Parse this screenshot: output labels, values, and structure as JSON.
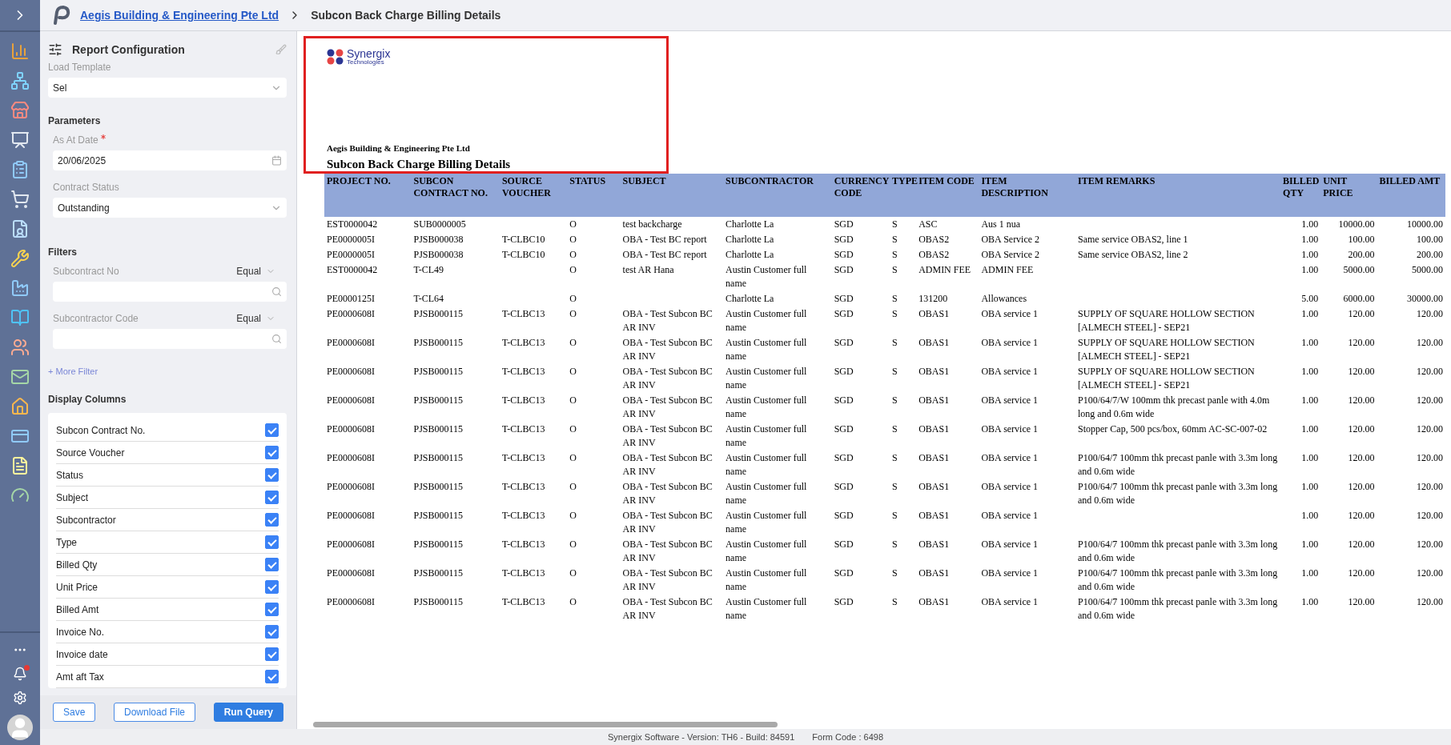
{
  "breadcrumb": [
    {
      "label": "Aegis Building & Engineering Pte Ltd",
      "kind": "link"
    },
    {
      "label": "Subcon Back Charge Billing Details",
      "kind": "current"
    }
  ],
  "config": {
    "title": "Report Configuration",
    "load_template": {
      "label": "Load Template",
      "value": "Sel"
    },
    "parameters_heading": "Parameters",
    "params": [
      {
        "label": "As At Date",
        "required": true,
        "value": "20/06/2025",
        "kind": "date"
      },
      {
        "label": "Contract Status",
        "required": false,
        "value": "Outstanding",
        "kind": "select"
      }
    ],
    "filters_heading": "Filters",
    "filters": [
      {
        "label": "Subcontract No",
        "operator": "Equal"
      },
      {
        "label": "Subcontractor Code",
        "operator": "Equal"
      }
    ],
    "more_filter": "+ More Filter",
    "display_heading": "Display Columns",
    "display_columns": [
      {
        "label": "Subcon Contract No.",
        "checked": true
      },
      {
        "label": "Source Voucher",
        "checked": true
      },
      {
        "label": "Status",
        "checked": true
      },
      {
        "label": "Subject",
        "checked": true
      },
      {
        "label": "Subcontractor",
        "checked": true
      },
      {
        "label": "Type",
        "checked": true
      },
      {
        "label": "Billed Qty",
        "checked": true
      },
      {
        "label": "Unit Price",
        "checked": true
      },
      {
        "label": "Billed Amt",
        "checked": true
      },
      {
        "label": "Invoice No.",
        "checked": true
      },
      {
        "label": "Invoice date",
        "checked": true
      },
      {
        "label": "Amt aft Tax",
        "checked": true
      }
    ],
    "buttons": [
      {
        "label": "Save",
        "kind": "outline"
      },
      {
        "label": "Download File",
        "kind": "outline"
      },
      {
        "label": "Run Query",
        "kind": "primary"
      }
    ]
  },
  "report": {
    "logo_name": "Synergix",
    "logo_sub": "Technologies",
    "company": "Aegis Building & Engineering Pte Ltd",
    "title": "Subcon Back Charge Billing Details",
    "columns": [
      {
        "label": "PROJECT NO.",
        "kind": "text"
      },
      {
        "label": "SUBCON CONTRACT NO.",
        "kind": "text"
      },
      {
        "label": "SOURCE VOUCHER",
        "kind": "text"
      },
      {
        "label": "STATUS",
        "kind": "text"
      },
      {
        "label": "SUBJECT",
        "kind": "text"
      },
      {
        "label": "SUBCONTRACTOR",
        "kind": "text"
      },
      {
        "label": "CURRENCY CODE",
        "kind": "text"
      },
      {
        "label": "TYPE",
        "kind": "text"
      },
      {
        "label": "ITEM CODE",
        "kind": "text"
      },
      {
        "label": "ITEM DESCRIPTION",
        "kind": "text"
      },
      {
        "label": "ITEM REMARKS",
        "kind": "text"
      },
      {
        "label": "BILLED QTY",
        "kind": "number"
      },
      {
        "label": "UNIT PRICE",
        "kind": "number"
      },
      {
        "label": "BILLED AMT",
        "kind": "number"
      }
    ],
    "rows": [
      [
        "EST0000042",
        "SUB0000005",
        null,
        "O",
        "test backcharge",
        "Charlotte La",
        "SGD",
        "S",
        "ASC",
        "Aus 1 nua",
        null,
        "1.00",
        "10000.00",
        "10000.00"
      ],
      [
        "PE0000005I",
        "PJSB000038",
        "T-CLBC10",
        "O",
        "OBA - Test BC report",
        "Charlotte La",
        "SGD",
        "S",
        "OBAS2",
        "OBA Service 2",
        "Same service OBAS2, line 1",
        "1.00",
        "100.00",
        "100.00"
      ],
      [
        "PE0000005I",
        "PJSB000038",
        "T-CLBC10",
        "O",
        "OBA - Test BC report",
        "Charlotte La",
        "SGD",
        "S",
        "OBAS2",
        "OBA Service 2",
        "Same service OBAS2, line  2",
        "1.00",
        "200.00",
        "200.00"
      ],
      [
        "EST0000042",
        "T-CL49",
        null,
        "O",
        "test AR Hana",
        "Austin Customer full name",
        "SGD",
        "S",
        "ADMIN FEE",
        "ADMIN FEE",
        null,
        "1.00",
        "5000.00",
        "5000.00"
      ],
      [
        "PE0000125I",
        "T-CL64",
        null,
        "O",
        null,
        "Charlotte La",
        "SGD",
        "S",
        "131200",
        "Allowances",
        null,
        "5.00",
        "6000.00",
        "30000.00"
      ],
      [
        "PE0000608I",
        "PJSB000115",
        "T-CLBC13",
        "O",
        "OBA - Test Subcon BC AR INV",
        "Austin Customer full name",
        "SGD",
        "S",
        "OBAS1",
        "OBA service 1",
        "SUPPLY OF SQUARE HOLLOW SECTION [ALMECH STEEL] - SEP21",
        "1.00",
        "120.00",
        "120.00"
      ],
      [
        "PE0000608I",
        "PJSB000115",
        "T-CLBC13",
        "O",
        "OBA - Test Subcon BC AR INV",
        "Austin Customer full name",
        "SGD",
        "S",
        "OBAS1",
        "OBA service 1",
        "SUPPLY OF SQUARE HOLLOW SECTION [ALMECH STEEL] - SEP21",
        "1.00",
        "120.00",
        "120.00"
      ],
      [
        "PE0000608I",
        "PJSB000115",
        "T-CLBC13",
        "O",
        "OBA - Test Subcon BC AR INV",
        "Austin Customer full name",
        "SGD",
        "S",
        "OBAS1",
        "OBA service 1",
        "SUPPLY OF SQUARE HOLLOW SECTION [ALMECH STEEL] - SEP21",
        "1.00",
        "120.00",
        "120.00"
      ],
      [
        "PE0000608I",
        "PJSB000115",
        "T-CLBC13",
        "O",
        "OBA - Test Subcon BC AR INV",
        "Austin Customer full name",
        "SGD",
        "S",
        "OBAS1",
        "OBA service 1",
        "P100/64/7/W 100mm thk precast panle with 4.0m long and 0.6m wide",
        "1.00",
        "120.00",
        "120.00"
      ],
      [
        "PE0000608I",
        "PJSB000115",
        "T-CLBC13",
        "O",
        "OBA - Test Subcon BC AR INV",
        "Austin Customer full name",
        "SGD",
        "S",
        "OBAS1",
        "OBA service 1",
        "Stopper Cap, 500 pcs/box, 60mm AC-SC-007-02",
        "1.00",
        "120.00",
        "120.00"
      ],
      [
        "PE0000608I",
        "PJSB000115",
        "T-CLBC13",
        "O",
        "OBA - Test Subcon BC AR INV",
        "Austin Customer full name",
        "SGD",
        "S",
        "OBAS1",
        "OBA service 1",
        "P100/64/7 100mm thk precast panle with 3.3m long and 0.6m wide",
        "1.00",
        "120.00",
        "120.00"
      ],
      [
        "PE0000608I",
        "PJSB000115",
        "T-CLBC13",
        "O",
        "OBA - Test Subcon BC AR INV",
        "Austin Customer full name",
        "SGD",
        "S",
        "OBAS1",
        "OBA service 1",
        "P100/64/7 100mm thk precast panle with 3.3m long and 0.6m wide",
        "1.00",
        "120.00",
        "120.00"
      ],
      [
        "PE0000608I",
        "PJSB000115",
        "T-CLBC13",
        "O",
        "OBA - Test Subcon BC AR INV",
        "Austin Customer full name",
        "SGD",
        "S",
        "OBAS1",
        "OBA service 1",
        null,
        "1.00",
        "120.00",
        "120.00"
      ],
      [
        "PE0000608I",
        "PJSB000115",
        "T-CLBC13",
        "O",
        "OBA - Test Subcon BC AR INV",
        "Austin Customer full name",
        "SGD",
        "S",
        "OBAS1",
        "OBA service 1",
        "P100/64/7 100mm thk precast panle with 3.3m long and 0.6m wide",
        "1.00",
        "120.00",
        "120.00"
      ],
      [
        "PE0000608I",
        "PJSB000115",
        "T-CLBC13",
        "O",
        "OBA - Test Subcon BC AR INV",
        "Austin Customer full name",
        "SGD",
        "S",
        "OBAS1",
        "OBA service 1",
        "P100/64/7 100mm thk precast panle with 3.3m long and 0.6m wide",
        "1.00",
        "120.00",
        "120.00"
      ],
      [
        "PE0000608I",
        "PJSB000115",
        "T-CLBC13",
        "O",
        "OBA - Test Subcon BC AR INV",
        "Austin Customer full name",
        "SGD",
        "S",
        "OBAS1",
        "OBA service 1",
        "P100/64/7 100mm thk precast panle with 3.3m long and 0.6m wide",
        "1.00",
        "120.00",
        "120.00"
      ]
    ]
  },
  "footer": {
    "version": "Synergix Software - Version: TH6 - Build: 84591",
    "form_code": "Form Code : 6498"
  }
}
